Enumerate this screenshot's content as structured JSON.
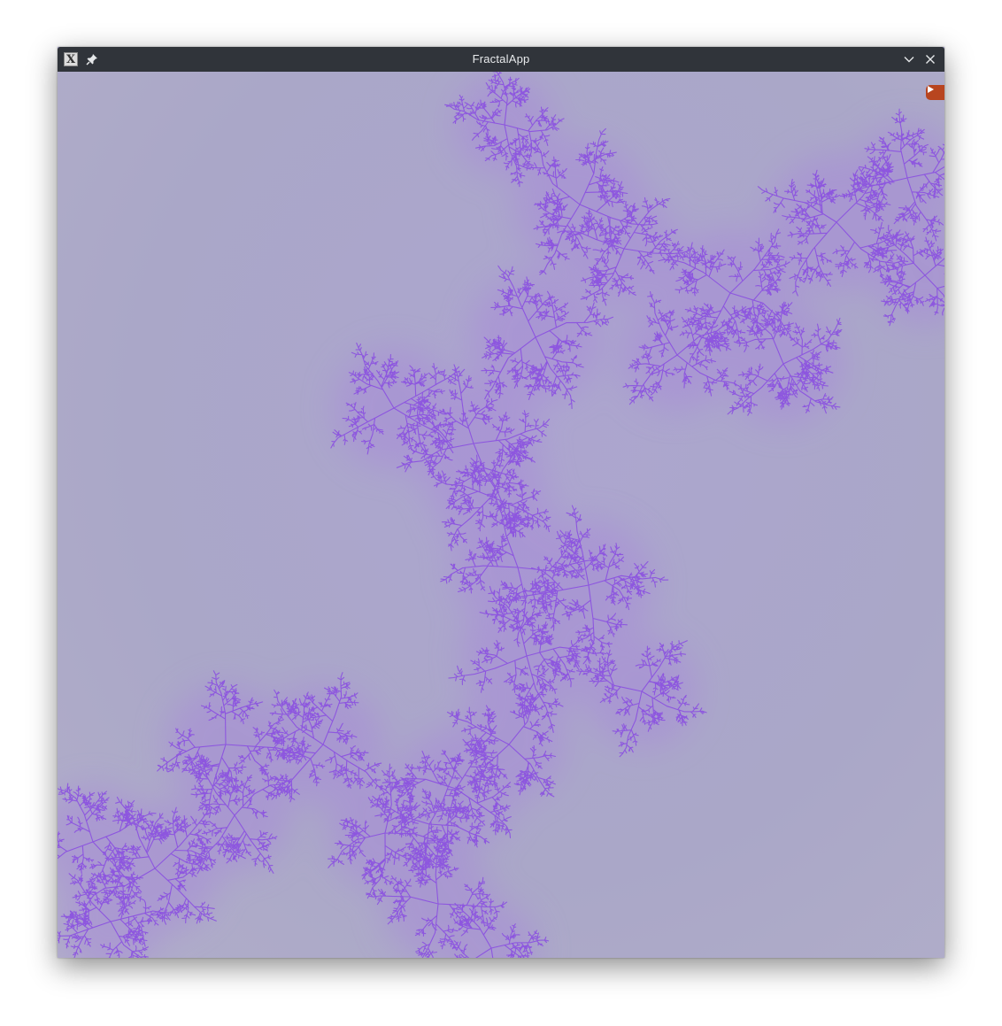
{
  "window": {
    "title": "FractalApp",
    "app_icon": "x-app-icon",
    "buttons": {
      "pin": "pin-icon",
      "minimize": "chevron-down-icon",
      "close": "close-icon"
    }
  },
  "canvas": {
    "content": "julia-set-fractal",
    "colors": {
      "background": "#aaa7c8",
      "fractal": "#8a4fe0",
      "glow": "#a78bd8"
    },
    "overlay_button": "play-icon"
  }
}
